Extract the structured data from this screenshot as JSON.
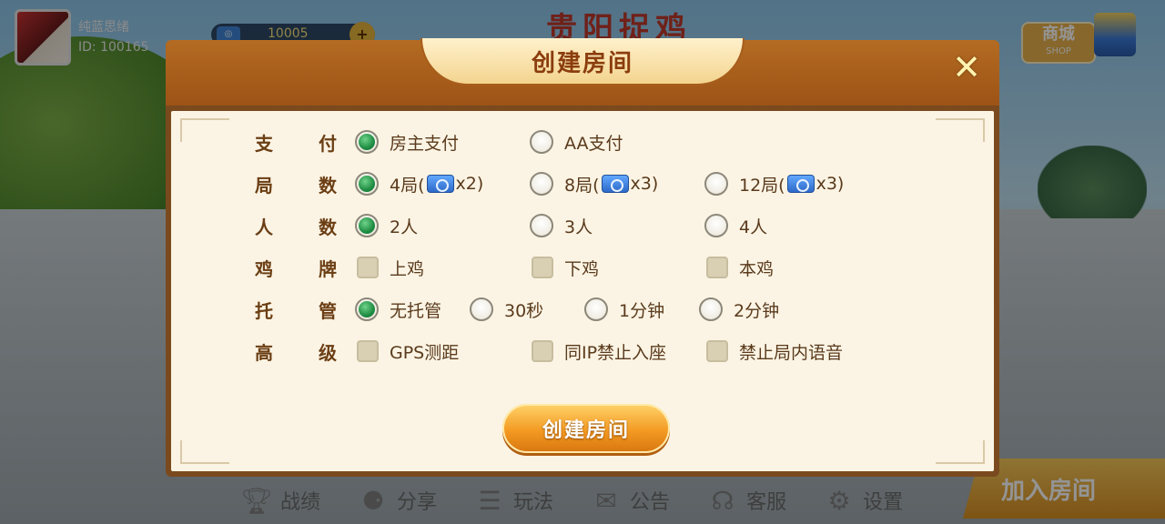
{
  "user": {
    "name": "纯蓝思绪",
    "id_text": "ID: 100165",
    "coins": "10005"
  },
  "shop": {
    "label": "商城",
    "sub": "SHOP"
  },
  "game_title": "贵阳捉鸡",
  "dialog": {
    "title": "创建房间",
    "create_button": "创建房间",
    "rows": {
      "pay": {
        "label_a": "支",
        "label_b": "付",
        "options": [
          "房主支付",
          "AA支付"
        ],
        "selected": 0
      },
      "rounds": {
        "label_a": "局",
        "label_b": "数",
        "options": [
          {
            "pre": "4局(",
            "post": "x2)"
          },
          {
            "pre": "8局(",
            "post": "x3)"
          },
          {
            "pre": "12局(",
            "post": "x3)"
          }
        ],
        "selected": 0
      },
      "players": {
        "label_a": "人",
        "label_b": "数",
        "options": [
          "2人",
          "3人",
          "4人"
        ],
        "selected": 0
      },
      "chicken": {
        "label_a": "鸡",
        "label_b": "牌",
        "options": [
          "上鸡",
          "下鸡",
          "本鸡"
        ]
      },
      "auto": {
        "label_a": "托",
        "label_b": "管",
        "options": [
          "无托管",
          "30秒",
          "1分钟",
          "2分钟"
        ],
        "selected": 0
      },
      "advanced": {
        "label_a": "高",
        "label_b": "级",
        "options": [
          "GPS测距",
          "同IP禁止入座",
          "禁止局内语音"
        ]
      }
    }
  },
  "bottom_nav": [
    {
      "label": "战绩",
      "icon": "trophy-icon"
    },
    {
      "label": "分享",
      "icon": "share-icon"
    },
    {
      "label": "玩法",
      "icon": "rules-icon"
    },
    {
      "label": "公告",
      "icon": "mail-icon"
    },
    {
      "label": "客服",
      "icon": "headset-icon"
    },
    {
      "label": "设置",
      "icon": "gear-icon"
    }
  ],
  "join_button": "加入房间",
  "colors": {
    "accent": "#f39a22",
    "header": "#a85d1b",
    "panel": "#fbf4e4",
    "radio_on": "#1f8d43"
  }
}
